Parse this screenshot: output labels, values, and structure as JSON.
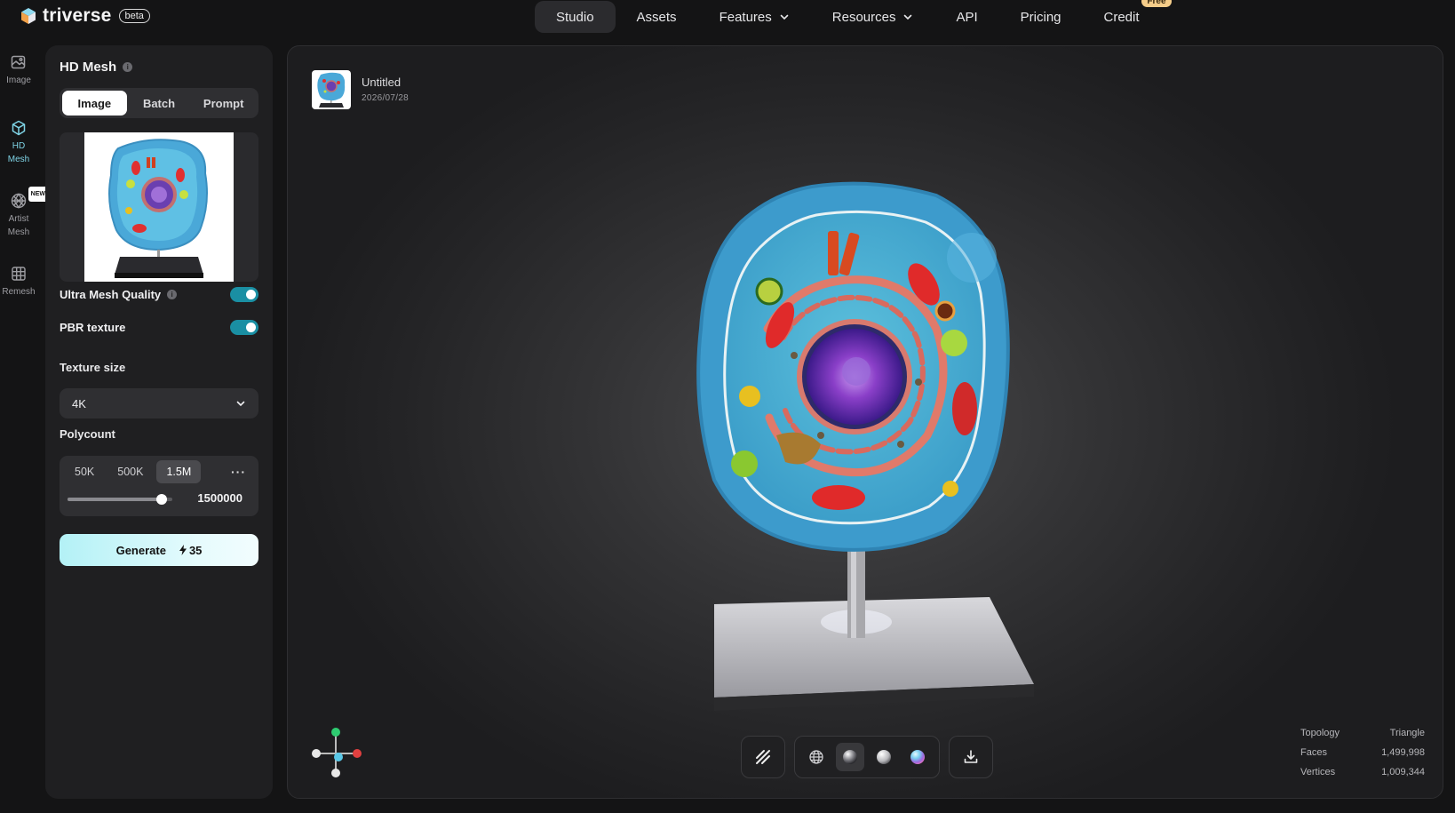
{
  "app": {
    "name": "triverse",
    "badge": "beta"
  },
  "nav": {
    "items": [
      {
        "label": "Studio",
        "active": true
      },
      {
        "label": "Assets"
      },
      {
        "label": "Features",
        "dropdown": true
      },
      {
        "label": "Resources",
        "dropdown": true
      },
      {
        "label": "API"
      },
      {
        "label": "Pricing"
      },
      {
        "label": "Credit",
        "badge": "Free"
      }
    ]
  },
  "rail": {
    "items": [
      {
        "label": "Image",
        "icon": "image-icon"
      },
      {
        "label": "HD\nMesh",
        "icon": "cube-icon",
        "active": true
      },
      {
        "label": "Artist\nMesh",
        "icon": "mesh-sphere-icon",
        "tag": "NEW"
      },
      {
        "label": "Remesh",
        "icon": "grid-icon"
      }
    ]
  },
  "panel": {
    "title": "HD Mesh",
    "tabs": [
      {
        "label": "Image",
        "active": true
      },
      {
        "label": "Batch"
      },
      {
        "label": "Prompt"
      }
    ],
    "ultra_mesh_quality": {
      "label": "Ultra Mesh Quality",
      "enabled": true
    },
    "pbr_texture": {
      "label": "PBR texture",
      "enabled": true
    },
    "texture_size": {
      "label": "Texture size",
      "value": "4K"
    },
    "polycount": {
      "label": "Polycount",
      "options": [
        "50K",
        "500K",
        "1.5M"
      ],
      "selected": "1.5M",
      "more": "···",
      "value": "1500000",
      "slider_fraction": 0.9
    },
    "generate": {
      "label": "Generate",
      "cost": "35"
    }
  },
  "viewport": {
    "asset_name": "Untitled",
    "asset_date": "2026/07/28",
    "stats": [
      {
        "label": "Topology",
        "value": "Triangle"
      },
      {
        "label": "Faces",
        "value": "1,499,998"
      },
      {
        "label": "Vertices",
        "value": "1,009,344"
      }
    ],
    "tools": [
      "wireframe-toggle-icon",
      "globe-icon",
      "sphere-shaded-icon",
      "sphere-matte-icon",
      "sphere-iridescent-icon",
      "download-icon"
    ]
  },
  "colors": {
    "accent": "#1a8fa3",
    "rail_active": "#7fd4e6",
    "credit_badge": "#f5cd8a"
  }
}
